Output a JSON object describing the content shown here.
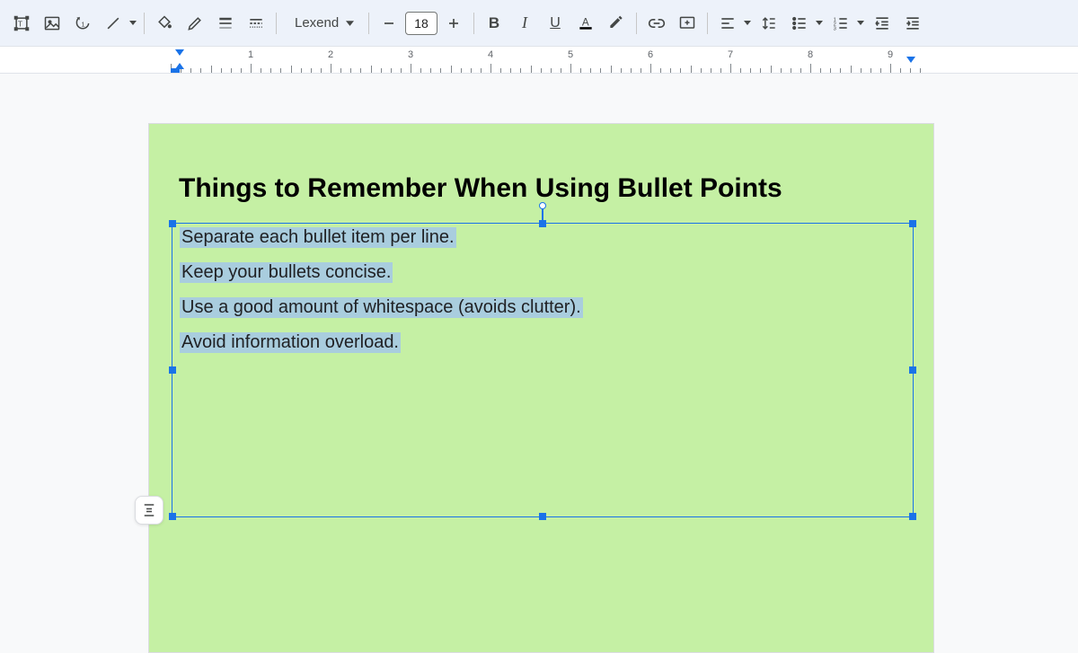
{
  "toolbar": {
    "font_name": "Lexend",
    "font_size": "18"
  },
  "ruler_numbers": [
    "1",
    "2",
    "3",
    "4",
    "5",
    "6",
    "7",
    "8",
    "9"
  ],
  "slide": {
    "title": "Things to Remember When Using Bullet Points",
    "bullets": [
      "Separate each bullet item per line.",
      "Keep your bullets concise.",
      "Use a good amount of whitespace (avoids clutter).",
      "Avoid information overload."
    ]
  }
}
